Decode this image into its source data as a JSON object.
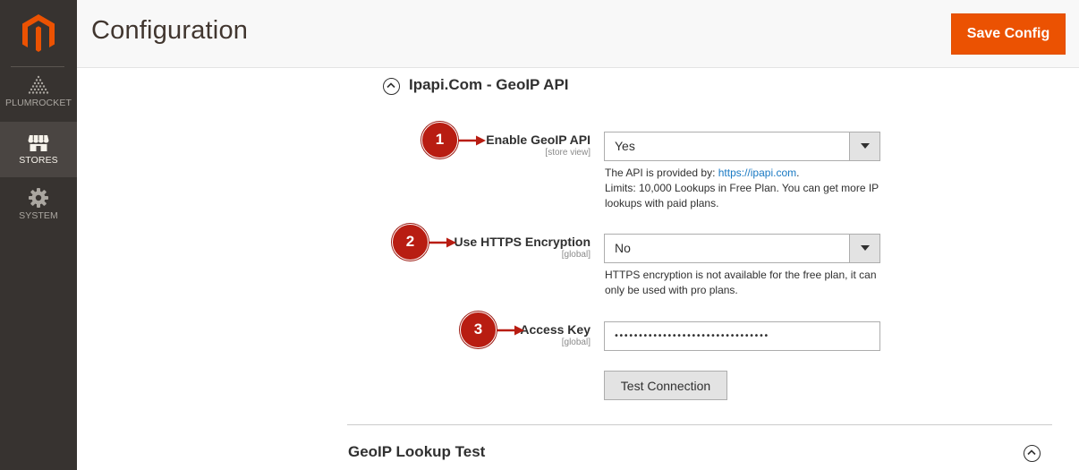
{
  "app": {
    "nav": [
      {
        "label": "PLUMROCKET",
        "icon": "plumrocket-logo-icon"
      },
      {
        "label": "STORES",
        "icon": "store-icon",
        "active": true
      },
      {
        "label": "SYSTEM",
        "icon": "gear-icon"
      }
    ],
    "logo_icon": "magento-logo-icon"
  },
  "header": {
    "title": "Configuration",
    "save_label": "Save Config"
  },
  "section": {
    "title": "Ipapi.Com - GeoIP API",
    "toggle_icon": "chevron-up-icon"
  },
  "fields": {
    "enable": {
      "label": "Enable GeoIP API",
      "scope": "[store view]",
      "value": "Yes",
      "note_prefix": "The API is provided by: ",
      "note_link": "https://ipapi.com",
      "note_suffix": ".",
      "note_line2": "Limits: 10,000 Lookups in Free Plan. You can get more IP lookups with paid plans."
    },
    "https": {
      "label": "Use HTTPS Encryption",
      "scope": "[global]",
      "value": "No",
      "note": "HTTPS encryption is not available for the free plan, it can only be used with pro plans."
    },
    "access_key": {
      "label": "Access Key",
      "scope": "[global]",
      "value": "••••••••••••••••••••••••••••••••"
    },
    "test_label": "Test Connection"
  },
  "lookup": {
    "title": "GeoIP Lookup Test"
  },
  "callouts": [
    "1",
    "2",
    "3"
  ],
  "colors": {
    "sidebar": "#373330",
    "accent": "#eb5202",
    "callout": "#b81d12",
    "link": "#1979c3"
  }
}
